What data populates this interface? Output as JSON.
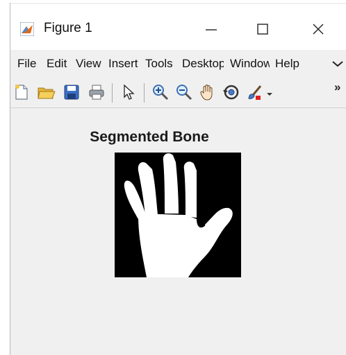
{
  "window": {
    "title": "Figure 1",
    "controls": {
      "minimize": "—",
      "maximize": "☐",
      "close": "✕"
    }
  },
  "menu": {
    "items": [
      {
        "label": "File"
      },
      {
        "label": "Edit"
      },
      {
        "label": "View"
      },
      {
        "label": "Insert"
      },
      {
        "label": "Tools"
      },
      {
        "label": "Desktop"
      },
      {
        "label": "Window"
      },
      {
        "label": "Help"
      }
    ]
  },
  "toolbar": {
    "icons": [
      "new-file-icon",
      "open-folder-icon",
      "save-icon",
      "print-icon",
      "pointer-icon",
      "zoom-in-icon",
      "zoom-out-icon",
      "pan-hand-icon",
      "rotate-3d-icon",
      "brush-icon"
    ],
    "overflow_label": "»"
  },
  "figure": {
    "axes_title": "Segmented Bone",
    "image_colors": {
      "background": "#000000",
      "foreground": "#ffffff"
    }
  },
  "colors": {
    "accent": "#3a7bd5",
    "window_bg": "#f0f0f0"
  }
}
